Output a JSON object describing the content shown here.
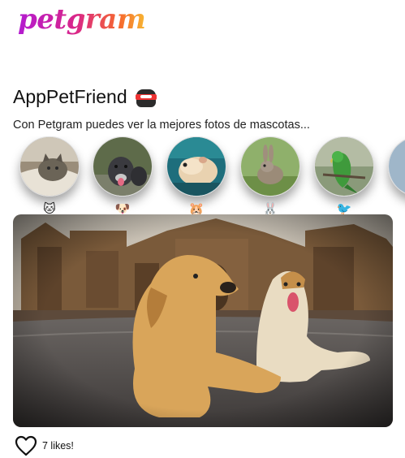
{
  "header": {
    "logo": "petgram"
  },
  "page": {
    "title": "AppPetFriend",
    "title_icon": "ninja-icon",
    "subtitle": "Con Petgram puedes ver la mejores fotos de mascotas..."
  },
  "categories": [
    {
      "name": "cats",
      "emoji": "🐱"
    },
    {
      "name": "dogs",
      "emoji": "🐶"
    },
    {
      "name": "hamsters",
      "emoji": "🐹"
    },
    {
      "name": "rabbits",
      "emoji": "🐰"
    },
    {
      "name": "birds",
      "emoji": "🐦"
    }
  ],
  "photo": {
    "subject": "two dogs lying in front of a cathedral"
  },
  "card": {
    "likes_text": "7 likes!",
    "like_icon": "heart-outline-icon"
  },
  "colors": {
    "logo_gradient": [
      "#b31bd0",
      "#d9268a",
      "#f6692d",
      "#f7b733"
    ],
    "text": "#222222"
  }
}
